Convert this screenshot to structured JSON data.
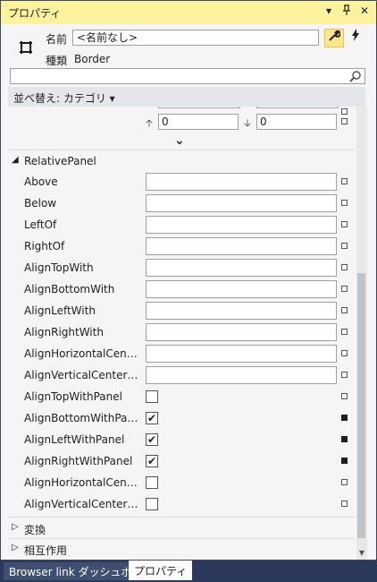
{
  "window": {
    "title": "プロパティ",
    "controls": [
      "▾",
      "ㅍ",
      "✕"
    ]
  },
  "header": {
    "name_label": "名前",
    "name_value": "<名前なし>",
    "type_label": "種類",
    "type_value": "Border"
  },
  "sort": {
    "label": "並べ替え: カテゴリ ▾"
  },
  "top_values": {
    "left": "0",
    "right": "0"
  },
  "relative_panel": {
    "label": "RelativePanel",
    "text_props": [
      {
        "label": "Above"
      },
      {
        "label": "Below"
      },
      {
        "label": "LeftOf"
      },
      {
        "label": "RightOf"
      },
      {
        "label": "AlignTopWith"
      },
      {
        "label": "AlignBottomWith"
      },
      {
        "label": "AlignLeftWith"
      },
      {
        "label": "AlignRightWith"
      },
      {
        "label": "AlignHorizontalCenter..."
      },
      {
        "label": "AlignVerticalCenterWith"
      }
    ],
    "bool_props": [
      {
        "label": "AlignTopWithPanel",
        "checked": false
      },
      {
        "label": "AlignBottomWithPanel",
        "checked": true
      },
      {
        "label": "AlignLeftWithPanel",
        "checked": true
      },
      {
        "label": "AlignRightWithPanel",
        "checked": true
      },
      {
        "label": "AlignHorizontalCenter...",
        "checked": false
      },
      {
        "label": "AlignVerticalCenterWit...",
        "checked": false
      }
    ]
  },
  "sections": [
    {
      "label": "変換"
    },
    {
      "label": "相互作用"
    }
  ],
  "bottom_tabs": [
    "Browser link ダッシュボード",
    "プロパティ"
  ],
  "colors": {
    "titlebar": "#fff29d",
    "accent": "#ffe78a",
    "frame": "#2b3a5a"
  }
}
